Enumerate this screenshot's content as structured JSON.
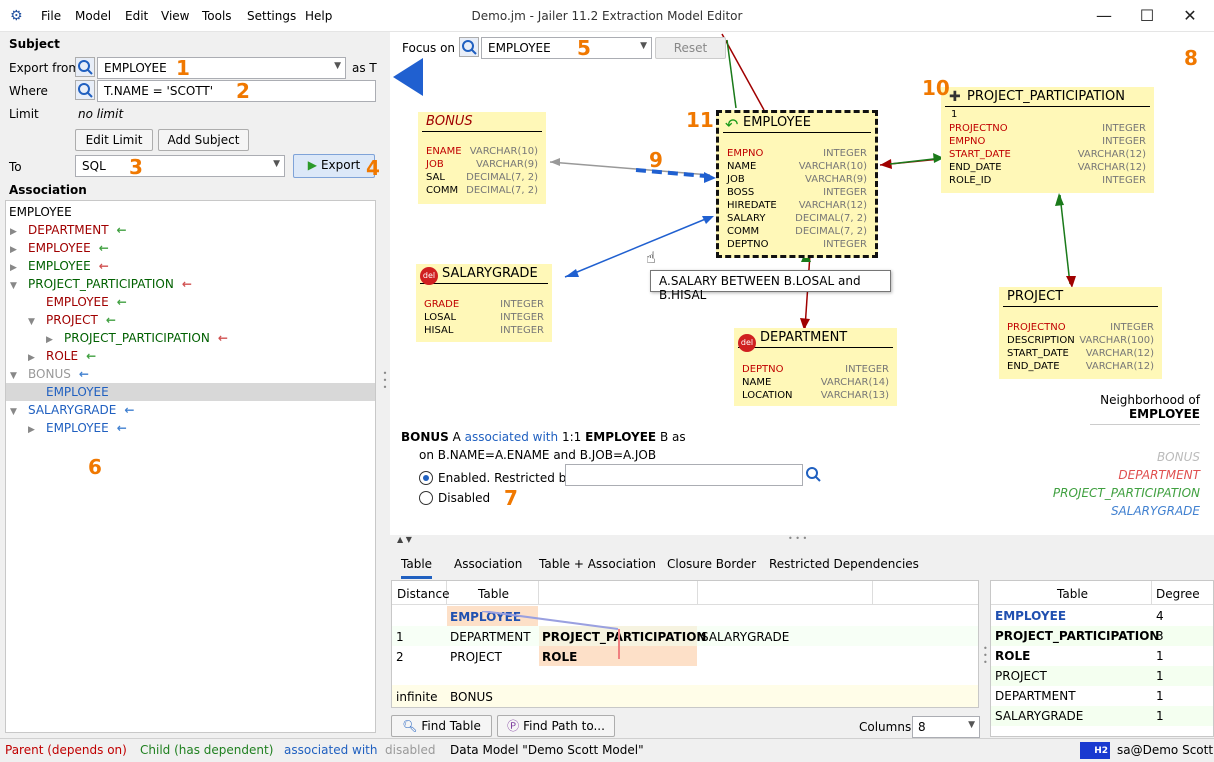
{
  "window": {
    "title": "Demo.jm - Jailer 11.2 Extraction Model Editor",
    "menu": [
      "File",
      "Model",
      "Edit",
      "View",
      "Tools",
      "Settings",
      "Help"
    ]
  },
  "subject": {
    "heading": "Subject",
    "export_from_label": "Export from",
    "export_from_value": "EMPLOYEE",
    "as_label": "as T",
    "where_label": "Where",
    "where_value": "T.NAME = 'SCOTT'",
    "limit_label": "Limit",
    "limit_value": "no limit",
    "edit_limit": "Edit Limit",
    "add_subject": "Add Subject",
    "to_label": "To",
    "to_value": "SQL",
    "export_btn": "Export"
  },
  "association": {
    "heading": "Association",
    "root": "EMPLOYEE",
    "rows": [
      {
        "label": "DEPARTMENT",
        "color": "#a00000",
        "arrow": "←",
        "arrow_color": "#40a040",
        "indent": 0,
        "tri": "▶"
      },
      {
        "label": "EMPLOYEE",
        "color": "#a00000",
        "arrow": "←",
        "arrow_color": "#40a040",
        "indent": 0,
        "tri": "▶"
      },
      {
        "label": "EMPLOYEE",
        "color": "#006000",
        "arrow": "←",
        "arrow_color": "#d05050",
        "indent": 0,
        "tri": "▶"
      },
      {
        "label": "PROJECT_PARTICIPATION",
        "color": "#006000",
        "arrow": "←",
        "arrow_color": "#d05050",
        "indent": 0,
        "tri": "▼"
      },
      {
        "label": "EMPLOYEE",
        "color": "#a00000",
        "arrow": "←",
        "arrow_color": "#40a040",
        "indent": 1,
        "tri": ""
      },
      {
        "label": "PROJECT",
        "color": "#a00000",
        "arrow": "←",
        "arrow_color": "#40a040",
        "indent": 1,
        "tri": "▼"
      },
      {
        "label": "PROJECT_PARTICIPATION",
        "color": "#006000",
        "arrow": "←",
        "arrow_color": "#d05050",
        "indent": 2,
        "tri": "▶"
      },
      {
        "label": "ROLE",
        "color": "#a00000",
        "arrow": "←",
        "arrow_color": "#40a040",
        "indent": 1,
        "tri": "▶"
      },
      {
        "label": "BONUS",
        "color": "#999999",
        "arrow": "←",
        "arrow_color": "#4080d0",
        "indent": 0,
        "tri": "▼"
      },
      {
        "label": "EMPLOYEE",
        "color": "#2060c0",
        "arrow": "",
        "arrow_color": "#4080d0",
        "indent": 1,
        "tri": "",
        "selected": true
      },
      {
        "label": "SALARYGRADE",
        "color": "#2060c0",
        "arrow": "←",
        "arrow_color": "#4080d0",
        "indent": 0,
        "tri": "▼"
      },
      {
        "label": "EMPLOYEE",
        "color": "#2060c0",
        "arrow": "←",
        "arrow_color": "#4080d0",
        "indent": 1,
        "tri": "▶"
      }
    ]
  },
  "annotations": [
    "1",
    "2",
    "3",
    "4",
    "5",
    "6",
    "7",
    "8",
    "9",
    "10",
    "11"
  ],
  "focus": {
    "label": "Focus on",
    "value": "EMPLOYEE",
    "reset": "Reset"
  },
  "tables": {
    "bonus": {
      "name": "BONUS",
      "cols": [
        [
          "ENAME",
          "VARCHAR(10)",
          true
        ],
        [
          "JOB",
          "VARCHAR(9)",
          true
        ],
        [
          "SAL",
          "DECIMAL(7, 2)",
          false
        ],
        [
          "COMM",
          "DECIMAL(7, 2)",
          false
        ]
      ]
    },
    "employee": {
      "name": "EMPLOYEE",
      "cols": [
        [
          "EMPNO",
          "INTEGER",
          true
        ],
        [
          "NAME",
          "VARCHAR(10)",
          false
        ],
        [
          "JOB",
          "VARCHAR(9)",
          false
        ],
        [
          "BOSS",
          "INTEGER",
          false
        ],
        [
          "HIREDATE",
          "VARCHAR(12)",
          false
        ],
        [
          "SALARY",
          "DECIMAL(7, 2)",
          false
        ],
        [
          "COMM",
          "DECIMAL(7, 2)",
          false
        ],
        [
          "DEPTNO",
          "INTEGER",
          false
        ]
      ]
    },
    "pp": {
      "name": "PROJECT_PARTICIPATION",
      "one": "1",
      "cols": [
        [
          "PROJECTNO",
          "INTEGER",
          true
        ],
        [
          "EMPNO",
          "INTEGER",
          true
        ],
        [
          "START_DATE",
          "VARCHAR(12)",
          true
        ],
        [
          "END_DATE",
          "VARCHAR(12)",
          false
        ],
        [
          "ROLE_ID",
          "INTEGER",
          false
        ]
      ]
    },
    "salarygrade": {
      "name": "SALARYGRADE",
      "cols": [
        [
          "GRADE",
          "INTEGER",
          true
        ],
        [
          "LOSAL",
          "INTEGER",
          false
        ],
        [
          "HISAL",
          "INTEGER",
          false
        ]
      ]
    },
    "department": {
      "name": "DEPARTMENT",
      "cols": [
        [
          "DEPTNO",
          "INTEGER",
          true
        ],
        [
          "NAME",
          "VARCHAR(14)",
          false
        ],
        [
          "LOCATION",
          "VARCHAR(13)",
          false
        ]
      ]
    },
    "project": {
      "name": "PROJECT",
      "cols": [
        [
          "PROJECTNO",
          "INTEGER",
          true
        ],
        [
          "DESCRIPTION",
          "VARCHAR(100)",
          false
        ],
        [
          "START_DATE",
          "VARCHAR(12)",
          false
        ],
        [
          "END_DATE",
          "VARCHAR(12)",
          false
        ]
      ]
    }
  },
  "tooltip": "A.SALARY BETWEEN B.LOSAL and B.HISAL",
  "del": "del",
  "neighborhood": {
    "line1": "Neighborhood of",
    "line2": "EMPLOYEE",
    "legend": [
      "BONUS",
      "DEPARTMENT",
      "PROJECT_PARTICIPATION",
      "SALARYGRADE"
    ]
  },
  "assoc_detail": {
    "from": "BONUS",
    "a": "A",
    "assoc": "associated with",
    "card": "1:1",
    "to": "EMPLOYEE",
    "b": "B as",
    "on": "on B.NAME=A.ENAME and B.JOB=A.JOB",
    "enabled": "Enabled. Restricted by",
    "disabled": "Disabled"
  },
  "bottom_tabs": [
    "Table",
    "Association",
    "Table + Association",
    "Closure Border",
    "Restricted Dependencies"
  ],
  "closure": {
    "headers": [
      "Distance",
      "Table"
    ],
    "rows": [
      [
        "",
        "EMPLOYEE",
        "",
        ""
      ],
      [
        "1",
        "DEPARTMENT",
        "PROJECT_PARTICIPATION",
        "SALARYGRADE"
      ],
      [
        "2",
        "PROJECT",
        "ROLE",
        ""
      ],
      [
        "",
        "",
        " ",
        ""
      ],
      [
        "infinite",
        "BONUS",
        "",
        ""
      ]
    ]
  },
  "find_table": "Find Table",
  "find_path": "Find Path to...",
  "columns_label": "Columns",
  "columns_value": "8",
  "degree": {
    "headers": [
      "Table",
      "Degree"
    ],
    "rows": [
      [
        "EMPLOYEE",
        "4"
      ],
      [
        "PROJECT_PARTICIPATION",
        "3"
      ],
      [
        "ROLE",
        "1"
      ],
      [
        "PROJECT",
        "1"
      ],
      [
        "DEPARTMENT",
        "1"
      ],
      [
        "SALARYGRADE",
        "1"
      ]
    ]
  },
  "status": {
    "parent": "Parent (depends on)",
    "child": "Child (has dependent)",
    "assoc": "associated with",
    "disabled": "disabled",
    "model": "Data Model \"Demo Scott Model\"",
    "h2": "H2",
    "user": "sa@Demo Scott"
  }
}
